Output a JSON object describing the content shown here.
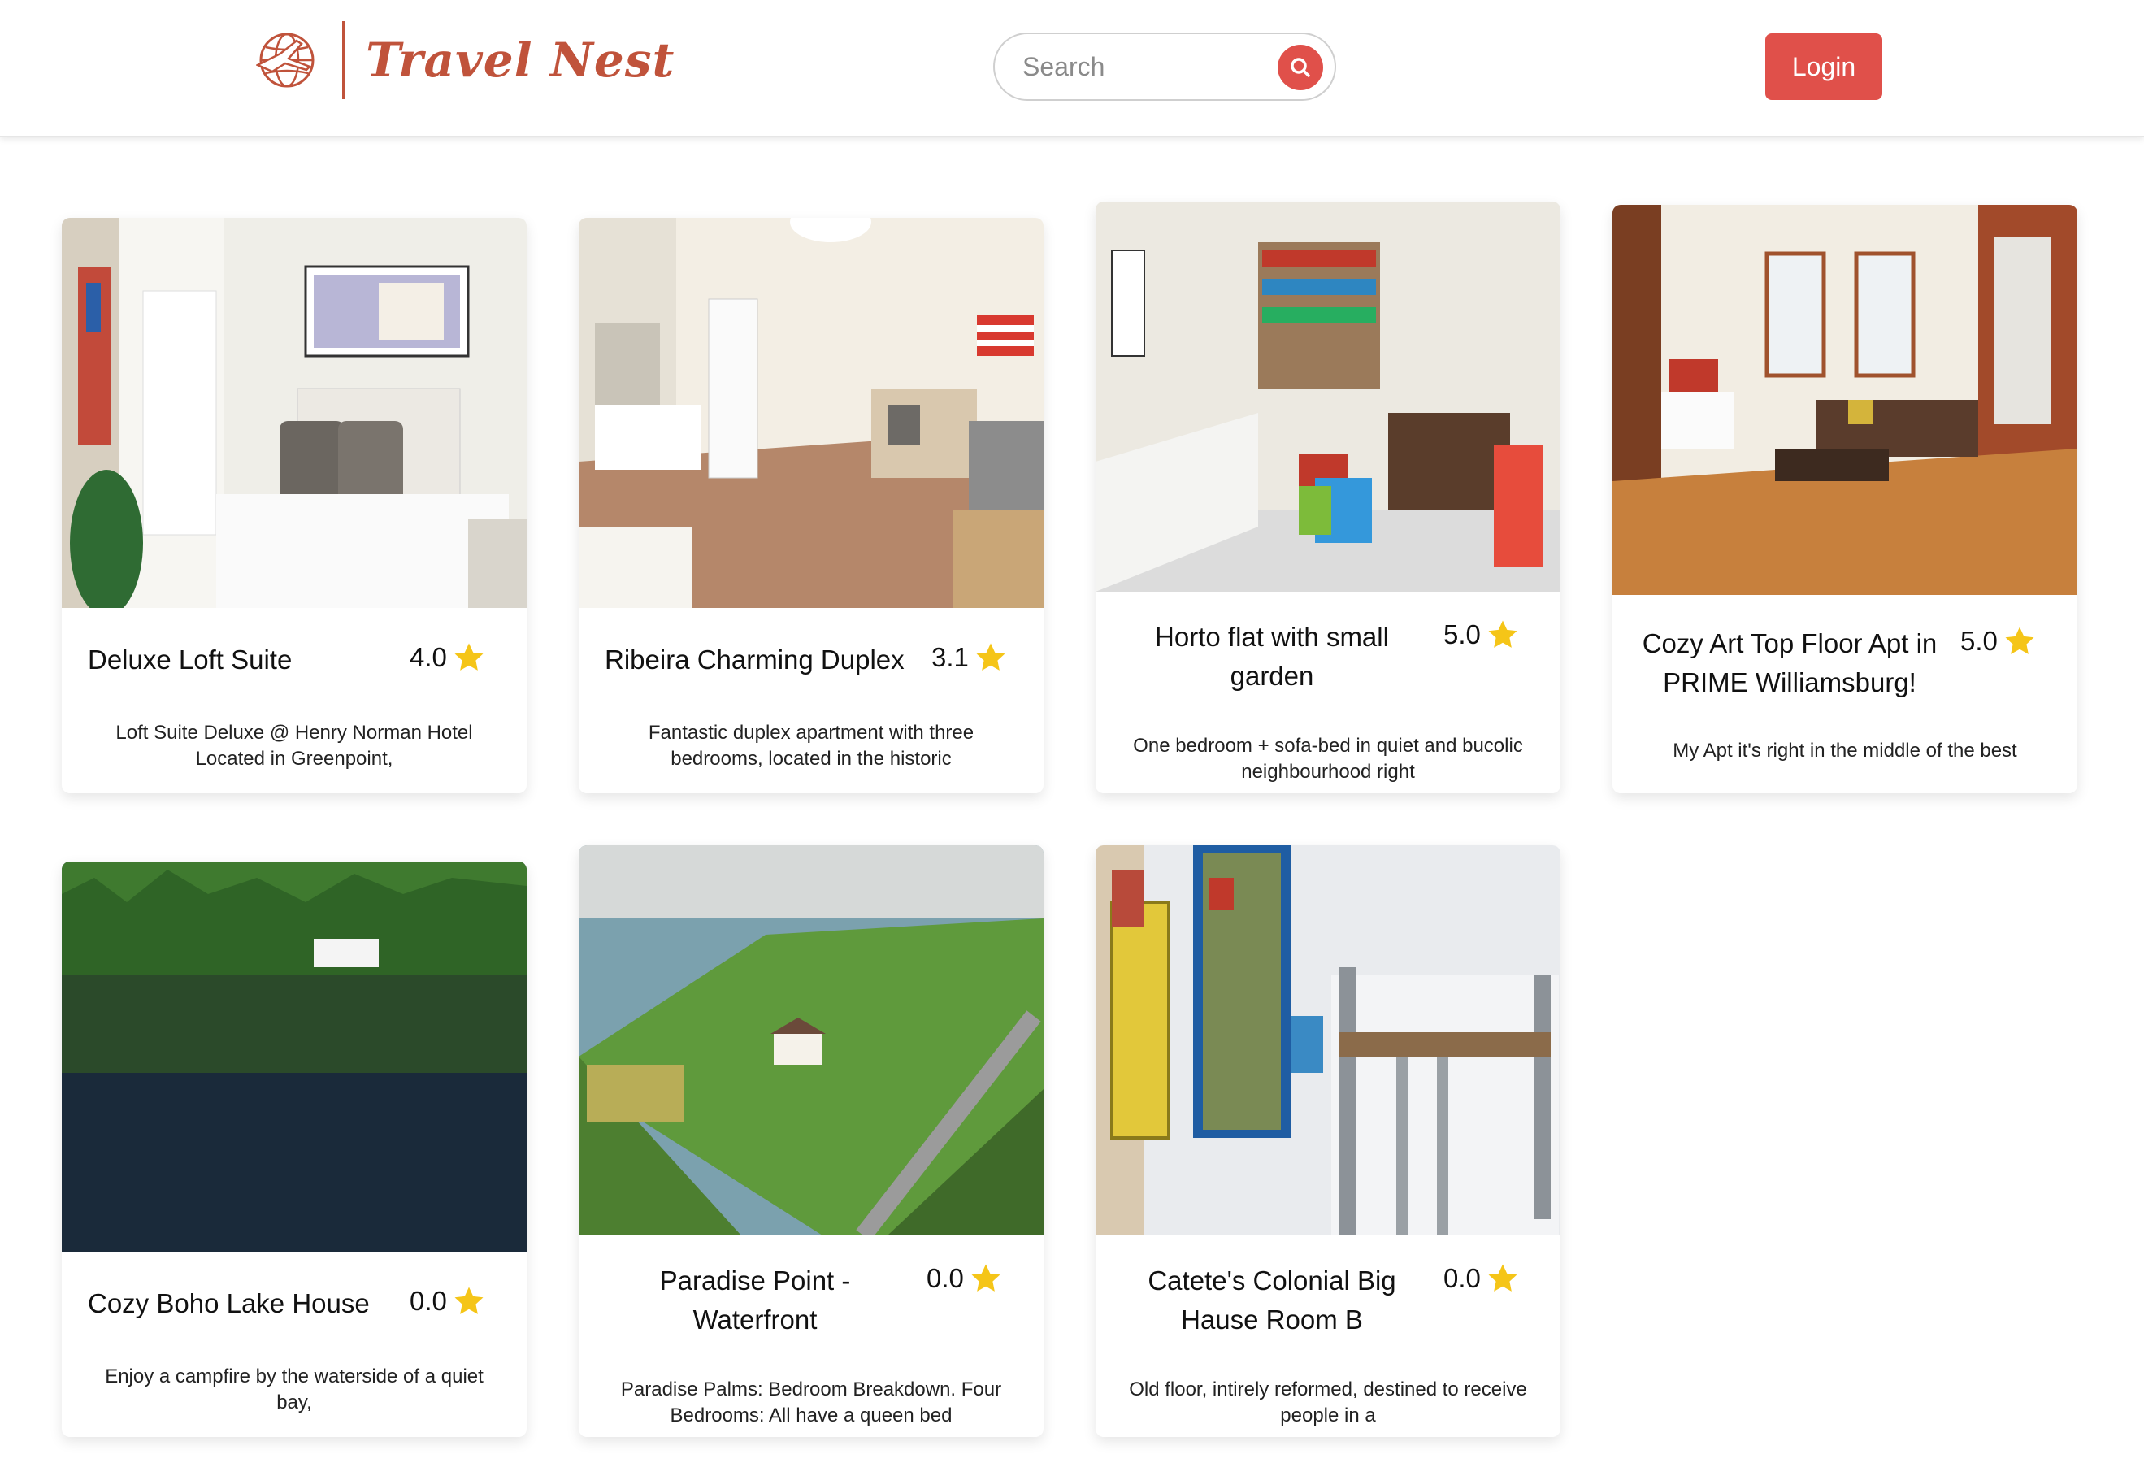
{
  "header": {
    "brand": "Travel Nest",
    "search_placeholder": "Search",
    "login_label": "Login"
  },
  "colors": {
    "accent": "#e0504a",
    "brand": "#c0533b",
    "star": "#f5c518"
  },
  "listings": [
    {
      "title": "Deluxe Loft Suite",
      "rating": "4.0",
      "description": "Loft Suite Deluxe @ Henry Norman Hotel Located in Greenpoint,"
    },
    {
      "title": "Ribeira Charming Duplex",
      "rating": "3.1",
      "description": "Fantastic duplex apartment with three bedrooms, located in the historic"
    },
    {
      "title": "Horto flat with small garden",
      "rating": "5.0",
      "description": "One bedroom + sofa-bed in quiet and bucolic neighbourhood right"
    },
    {
      "title": "Cozy Art Top Floor Apt in PRIME Williamsburg!",
      "rating": "5.0",
      "description": "My Apt it's right in the middle of the best"
    },
    {
      "title": "Cozy Boho Lake House",
      "rating": "0.0",
      "description": "Enjoy a campfire by the waterside of a quiet bay,"
    },
    {
      "title": "Paradise Point - Waterfront",
      "rating": "0.0",
      "description": "Paradise Palms: Bedroom Breakdown. Four Bedrooms: All have a queen bed"
    },
    {
      "title": "Catete's Colonial Big Hause Room B",
      "rating": "0.0",
      "description": "Old floor, intirely reformed, destined to receive people in a"
    }
  ]
}
